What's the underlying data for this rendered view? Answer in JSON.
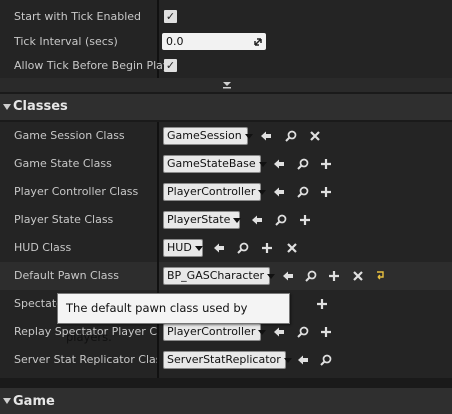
{
  "tick": {
    "start_with_tick_enabled": "Start with Tick Enabled",
    "tick_interval_label": "Tick Interval (secs)",
    "tick_interval_value": "0.0",
    "allow_tick_before_begin_play": "Allow Tick Before Begin Play"
  },
  "classes": {
    "header": "Classes",
    "rows": [
      {
        "label": "Game Session Class",
        "value": "GameSession"
      },
      {
        "label": "Game State Class",
        "value": "GameStateBase"
      },
      {
        "label": "Player Controller Class",
        "value": "PlayerController"
      },
      {
        "label": "Player State Class",
        "value": "PlayerState"
      },
      {
        "label": "HUD Class",
        "value": "HUD"
      },
      {
        "label": "Default Pawn Class",
        "value": "BP_GASCharacter"
      },
      {
        "label": "Spectator",
        "value": ""
      },
      {
        "label": "Replay Spectator Player Con",
        "value": "PlayerController"
      },
      {
        "label": "Server Stat Replicator Class",
        "value": "ServerStatReplicator"
      }
    ]
  },
  "tooltip": {
    "text": "The default pawn class used by players."
  },
  "game": {
    "header": "Game"
  },
  "colors": {
    "background": "#242424",
    "category": "#2f2f2f",
    "accent_reset": "#e8c040"
  }
}
